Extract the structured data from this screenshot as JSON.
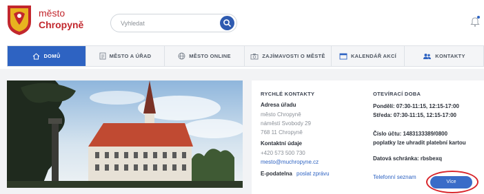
{
  "header": {
    "brand_line1": "město",
    "brand_line2": "Chropyně",
    "search_placeholder": "Vyhledat"
  },
  "nav": {
    "items": [
      {
        "label": "DOMŮ",
        "icon": "home-icon"
      },
      {
        "label": "MĚSTO A ÚŘAD",
        "icon": "document-icon"
      },
      {
        "label": "MĚSTO ONLINE",
        "icon": "globe-icon"
      },
      {
        "label": "ZAJÍMAVOSTI O MĚSTĚ",
        "icon": "camera-icon"
      },
      {
        "label": "KALENDÁŘ AKCÍ",
        "icon": "calendar-icon"
      },
      {
        "label": "KONTAKTY",
        "icon": "people-icon"
      }
    ]
  },
  "contacts": {
    "title": "RYCHLÉ KONTAKTY",
    "address_label": "Adresa úřadu",
    "address_lines": [
      "město Chropyně",
      "náměstí Svobody 29",
      "768 11 Chropyně"
    ],
    "contact_label": "Kontaktní údaje",
    "phone": "+420 573 500 730",
    "email": "mesto@muchropyne.cz",
    "epodatelna_label": "E-podatelna",
    "epodatelna_link": "poslat zprávu"
  },
  "hours": {
    "title": "OTEVÍRACÍ DOBA",
    "mon": "Pondělí: 07:30-11:15, 12:15-17:00",
    "wed": "Středa: 07:30-11:15, 12:15-17:00",
    "account": "Číslo účtu: 1483133389/0800",
    "fees": "poplatky lze uhradit platební kartou",
    "databox": "Datová schránka: rbsbexq",
    "phonebook_link": "Telefonní seznam",
    "more_button": "Více"
  }
}
